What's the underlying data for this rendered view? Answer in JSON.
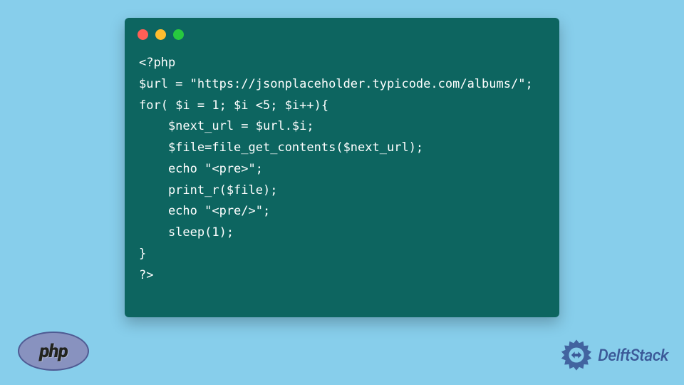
{
  "code": {
    "lines": [
      "<?php",
      "$url = \"https://jsonplaceholder.typicode.com/albums/\";",
      "for( $i = 1; $i <5; $i++){",
      "    $next_url = $url.$i;",
      "    $file=file_get_contents($next_url);",
      "    echo \"<pre>\";",
      "    print_r($file);",
      "    echo \"<pre/>\";",
      "    sleep(1);",
      "}",
      "?>"
    ]
  },
  "logos": {
    "php": "php",
    "delft": "DelftStack"
  },
  "colors": {
    "bg": "#87ceeb",
    "codeBg": "#0d6560",
    "codeText": "#ffffff",
    "phpLogoBg": "#8892bf",
    "delftBlue": "#3b5998"
  }
}
